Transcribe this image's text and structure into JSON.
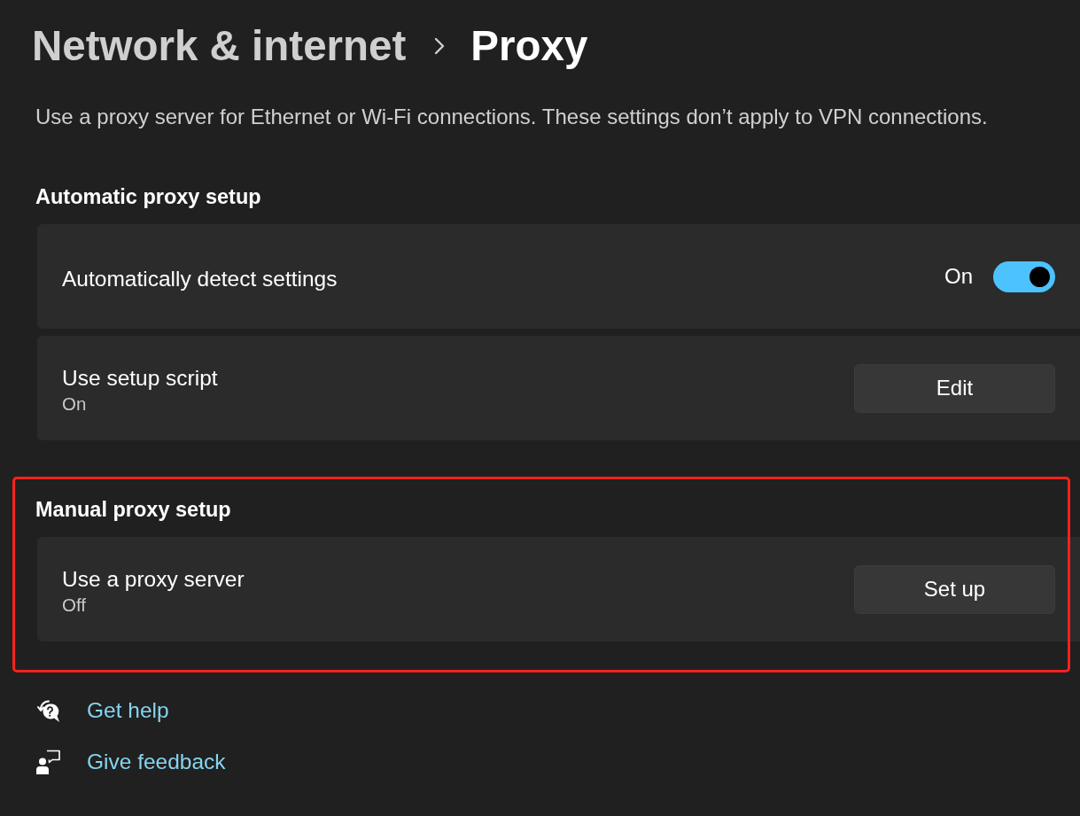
{
  "breadcrumb": [
    {
      "label": "Network & internet",
      "current": false
    },
    {
      "label": "Proxy",
      "current": true
    }
  ],
  "description": "Use a proxy server for Ethernet or Wi-Fi connections. These settings don’t apply to VPN connections.",
  "sections": [
    {
      "title": "Automatic proxy setup",
      "highlighted": false,
      "rows": [
        {
          "kind": "toggle",
          "title": "Automatically detect settings",
          "state_label": "On",
          "on": true
        },
        {
          "kind": "button",
          "title": "Use setup script",
          "subtitle": "On",
          "button": "Edit"
        }
      ]
    },
    {
      "title": "Manual proxy setup",
      "highlighted": true,
      "rows": [
        {
          "kind": "button",
          "title": "Use a proxy server",
          "subtitle": "Off",
          "button": "Set up"
        }
      ]
    }
  ],
  "links": [
    {
      "kind": "help",
      "label": "Get help"
    },
    {
      "kind": "feedback",
      "label": "Give feedback"
    }
  ]
}
